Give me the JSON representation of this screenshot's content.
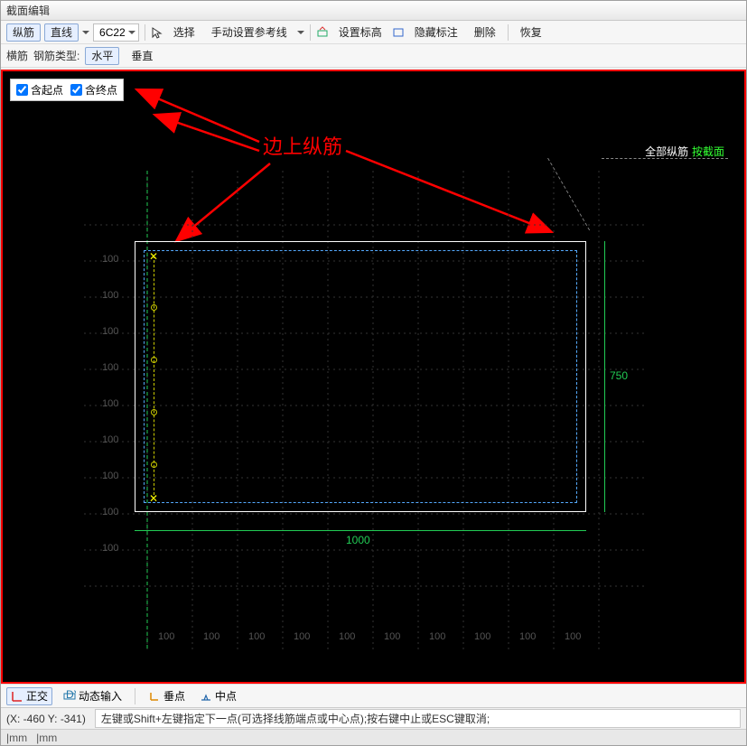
{
  "window": {
    "title": "截面编辑"
  },
  "toolbar1": {
    "btn_zongjin": "纵筋",
    "btn_zhixian": "直线",
    "spec": "6C22",
    "btn_select": "选择",
    "btn_refline": "手动设置参考线",
    "btn_elev": "设置标高",
    "btn_hideanno": "隐藏标注",
    "btn_delete": "删除",
    "btn_restore": "恢复"
  },
  "toolbar2": {
    "lbl_hengjin": "横筋",
    "lbl_type": "钢筋类型:",
    "btn_horiz": "水平",
    "btn_vert": "垂直"
  },
  "checkboxes": {
    "start": "含起点",
    "end": "含终点"
  },
  "annotation": "边上纵筋",
  "hint": {
    "all": "全部纵筋",
    "bysection": "按截面"
  },
  "dimensions": {
    "width": "1000",
    "height": "750"
  },
  "grid_labels_y": [
    "100",
    "100",
    "100",
    "100",
    "100",
    "100",
    "100",
    "100",
    "100"
  ],
  "grid_labels_x": [
    "100",
    "100",
    "100",
    "100",
    "100",
    "100",
    "100",
    "100",
    "100",
    "100"
  ],
  "bottom": {
    "ortho": "正交",
    "dyninput": "动态输入",
    "perp": "垂点",
    "mid": "中点"
  },
  "status": {
    "coords": "(X: -460 Y: -341)",
    "prompt": "左键或Shift+左键指定下一点(可选择线筋端点或中心点);按右键中止或ESC键取消;"
  },
  "snapbar": {
    "mm1": "|mm",
    "mm2": "|mm"
  }
}
